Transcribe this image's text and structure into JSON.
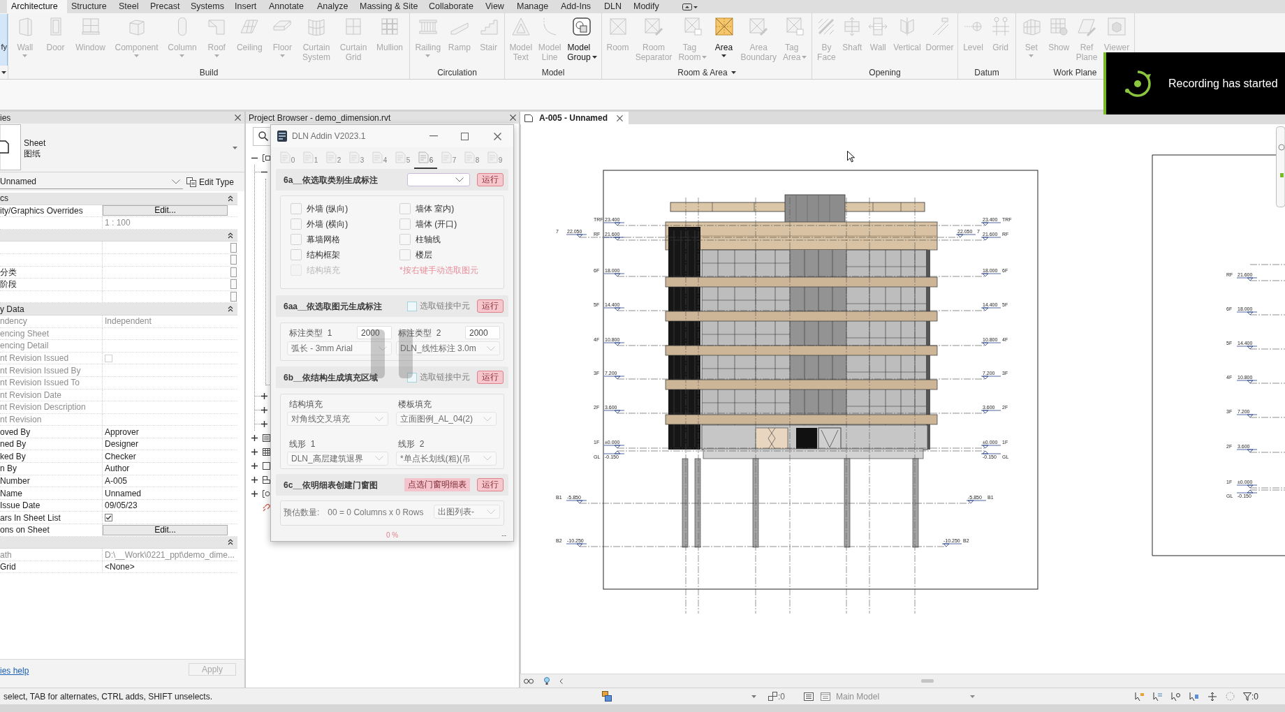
{
  "ribbon": {
    "tabs": [
      {
        "label": "Architecture",
        "selected": true
      },
      {
        "label": "Structure",
        "selected": false
      },
      {
        "label": "Steel",
        "selected": false
      },
      {
        "label": "Precast",
        "selected": false
      },
      {
        "label": "Systems",
        "selected": false
      },
      {
        "label": "Insert",
        "selected": false
      },
      {
        "label": "Annotate",
        "selected": false
      },
      {
        "label": "Analyze",
        "selected": false
      },
      {
        "label": "Massing & Site",
        "selected": false
      },
      {
        "label": "Collaborate",
        "selected": false
      },
      {
        "label": "View",
        "selected": false
      },
      {
        "label": "Manage",
        "selected": false
      },
      {
        "label": "Add-Ins",
        "selected": false
      },
      {
        "label": "DLN",
        "selected": false
      },
      {
        "label": "Modify",
        "selected": false
      }
    ],
    "modify_tool": {
      "label": "fy",
      "selected": true
    },
    "panels": [
      {
        "label": "Build",
        "menu": false,
        "tools": [
          {
            "label": "Wall",
            "disabled": true,
            "kind": "dropdown"
          },
          {
            "label": "Door",
            "disabled": true,
            "kind": "plain"
          },
          {
            "label": "Window",
            "disabled": true,
            "kind": "plain"
          },
          {
            "label": "Component",
            "disabled": true,
            "kind": "dropdown"
          },
          {
            "label": "Column",
            "disabled": true,
            "kind": "dropdown"
          },
          {
            "label": "Roof",
            "disabled": true,
            "kind": "dropdown"
          },
          {
            "label": "Ceiling",
            "disabled": true,
            "kind": "plain"
          },
          {
            "label": "Floor",
            "disabled": true,
            "kind": "dropdown"
          },
          {
            "label": "Curtain System",
            "disabled": true,
            "kind": "plain"
          },
          {
            "label": "Curtain Grid",
            "disabled": true,
            "kind": "plain"
          },
          {
            "label": "Mullion",
            "disabled": true,
            "kind": "plain"
          }
        ]
      },
      {
        "label": "Circulation",
        "menu": false,
        "tools": [
          {
            "label": "Railing",
            "disabled": true,
            "kind": "dropdown"
          },
          {
            "label": "Ramp",
            "disabled": true,
            "kind": "plain"
          },
          {
            "label": "Stair",
            "disabled": true,
            "kind": "plain"
          }
        ]
      },
      {
        "label": "Model",
        "menu": false,
        "tools": [
          {
            "label": "Model Text",
            "disabled": true,
            "kind": "plain"
          },
          {
            "label": "Model Line",
            "disabled": true,
            "kind": "plain"
          },
          {
            "label": "Model Group",
            "disabled": false,
            "kind": "sidemenu"
          }
        ]
      },
      {
        "label": "Room & Area",
        "menu": true,
        "tools": [
          {
            "label": "Room",
            "disabled": true,
            "kind": "plain"
          },
          {
            "label": "Room Separator",
            "disabled": true,
            "kind": "plain"
          },
          {
            "label": "Tag Room",
            "disabled": true,
            "kind": "sidemenu"
          },
          {
            "label": "Area",
            "disabled": false,
            "kind": "dropdown"
          },
          {
            "label": "Area Boundary",
            "disabled": true,
            "kind": "plain"
          },
          {
            "label": "Tag Area",
            "disabled": true,
            "kind": "sidemenu"
          }
        ]
      },
      {
        "label": "Opening",
        "menu": false,
        "tools": [
          {
            "label": "By Face",
            "disabled": true,
            "kind": "plain"
          },
          {
            "label": "Shaft",
            "disabled": true,
            "kind": "plain"
          },
          {
            "label": "Wall",
            "disabled": true,
            "kind": "plain"
          },
          {
            "label": "Vertical",
            "disabled": true,
            "kind": "plain"
          },
          {
            "label": "Dormer",
            "disabled": true,
            "kind": "plain"
          }
        ]
      },
      {
        "label": "Datum",
        "menu": false,
        "tools": [
          {
            "label": "Level",
            "disabled": true,
            "kind": "plain"
          },
          {
            "label": "Grid",
            "disabled": true,
            "kind": "plain"
          }
        ]
      },
      {
        "label": "Work Plane",
        "menu": false,
        "tools": [
          {
            "label": "Set",
            "disabled": true,
            "kind": "dropdown"
          },
          {
            "label": "Show",
            "disabled": true,
            "kind": "plain"
          },
          {
            "label": "Ref Plane",
            "disabled": true,
            "kind": "plain"
          },
          {
            "label": "Viewer",
            "disabled": true,
            "kind": "plain"
          }
        ]
      }
    ]
  },
  "recording_toast": {
    "message": "Recording has started"
  },
  "properties": {
    "title": "ies",
    "type_name": "Sheet",
    "type_subname": "图纸",
    "instance": "Unnamed",
    "edit_type": "Edit Type",
    "rows": [
      {
        "kind": "section",
        "label": "cs"
      },
      {
        "kind": "button",
        "label": "ity/Graphics Overrides",
        "value": "Edit..."
      },
      {
        "kind": "text",
        "value": "1 : 100",
        "disabled": true
      },
      {
        "kind": "section"
      },
      {
        "kind": "browse"
      },
      {
        "kind": "browse"
      },
      {
        "kind": "browse",
        "label": "分类"
      },
      {
        "kind": "browse",
        "label": "阶段"
      },
      {
        "kind": "browse"
      },
      {
        "kind": "section",
        "label": "y Data"
      },
      {
        "kind": "text",
        "label": "ndency",
        "value": "Independent",
        "disabled": true
      },
      {
        "kind": "text",
        "label": "encing Sheet",
        "disabled": true
      },
      {
        "kind": "text",
        "label": "encing Detail",
        "disabled": true
      },
      {
        "kind": "checkbox",
        "label": "nt Revision Issued",
        "checked": false,
        "disabled": true
      },
      {
        "kind": "text",
        "label": "nt Revision Issued By",
        "disabled": true
      },
      {
        "kind": "text",
        "label": "nt Revision Issued To",
        "disabled": true
      },
      {
        "kind": "text",
        "label": "nt Revision Date",
        "disabled": true
      },
      {
        "kind": "text",
        "label": "nt Revision Description",
        "disabled": true
      },
      {
        "kind": "text",
        "label": "nt Revision",
        "disabled": true
      },
      {
        "kind": "text",
        "label": "oved By",
        "value": "Approver",
        "disabled": false
      },
      {
        "kind": "text",
        "label": "ned By",
        "value": "Designer",
        "disabled": false
      },
      {
        "kind": "text",
        "label": "ked By",
        "value": "Checker",
        "disabled": false
      },
      {
        "kind": "text",
        "label": "n By",
        "value": "Author",
        "disabled": false
      },
      {
        "kind": "text",
        "label": "Number",
        "value": "A-005",
        "disabled": false
      },
      {
        "kind": "text",
        "label": "Name",
        "value": "Unnamed",
        "disabled": false
      },
      {
        "kind": "text",
        "label": "Issue Date",
        "value": "09/05/23",
        "disabled": false
      },
      {
        "kind": "checkbox",
        "label": "ars In Sheet List",
        "checked": true,
        "disabled": false
      },
      {
        "kind": "button",
        "label": "ons on Sheet",
        "value": "Edit..."
      },
      {
        "kind": "section"
      },
      {
        "kind": "text",
        "label": "ath",
        "value": "D:\\__Work\\0221_ppt\\demo_dime...",
        "disabled": true
      },
      {
        "kind": "text",
        "label": "Grid",
        "value": "<None>",
        "disabled": false
      }
    ],
    "help_link": "ies help",
    "apply": {
      "label": "Apply",
      "disabled": true
    }
  },
  "project_browser": {
    "title": "Project Browser - demo_dimension.rvt",
    "tree": [
      {
        "expanded": true,
        "children": [
          {
            "expanded": true
          },
          {
            "expanded": false
          },
          {
            "expanded": false
          },
          {
            "expanded": false
          }
        ]
      },
      {
        "expanded": false
      },
      {
        "expanded": false
      },
      {
        "expanded": false
      },
      {
        "expanded": false
      },
      {
        "expanded": false
      },
      {
        "leaf": true
      }
    ]
  },
  "addin_dialog": {
    "title": "DLN Addin V2023.1",
    "tabs": [
      {
        "label": "0",
        "selected": false
      },
      {
        "label": "1",
        "selected": false
      },
      {
        "label": "2",
        "selected": false
      },
      {
        "label": "3",
        "selected": false
      },
      {
        "label": "4",
        "selected": false
      },
      {
        "label": "5",
        "selected": false
      },
      {
        "label": "6",
        "selected": true
      },
      {
        "label": "7",
        "selected": false
      },
      {
        "label": "8",
        "selected": false
      },
      {
        "label": "9",
        "selected": false
      }
    ],
    "sections": [
      {
        "kind": "categories",
        "title": "6a__依选取类别生成标注",
        "run": "运行",
        "options": [
          {
            "label": "外墙 (纵向)",
            "checked": false,
            "disabled": false
          },
          {
            "label": "墙体 室内)",
            "checked": false,
            "disabled": false
          },
          {
            "label": "外墙 (横向)",
            "checked": false,
            "disabled": false
          },
          {
            "label": "墙体 (开口)",
            "checked": false,
            "disabled": false
          },
          {
            "label": "幕墙网格",
            "checked": false,
            "disabled": false
          },
          {
            "label": "柱轴线",
            "checked": false,
            "disabled": false
          },
          {
            "label": "结构框架",
            "checked": false,
            "disabled": false
          },
          {
            "label": "楼层",
            "checked": false,
            "disabled": false
          },
          {
            "label": "结构填充",
            "checked": false,
            "disabled": true
          }
        ],
        "hint": "*按右键手动选取图元"
      },
      {
        "kind": "pick",
        "title": "6aa__依选取图元生成标注",
        "link_option": {
          "label": "选取链接中元",
          "checked": false
        },
        "run": "运行",
        "fields": [
          {
            "label": "标注类型  1",
            "value": "2000",
            "style": "弧长 - 3mm Arial"
          },
          {
            "label": "标注类型  2",
            "value": "2000",
            "style": "DLN_线性标注 3.0m"
          }
        ]
      },
      {
        "kind": "fill",
        "title": "6b__依结构生成填充区域",
        "link_option": {
          "label": "选取链接中元",
          "checked": false
        },
        "run": "运行",
        "fields": [
          {
            "label": "结构填充",
            "value": "对角线交叉填充"
          },
          {
            "label": "楼板填充",
            "value": "立面图例_AL_04(2)"
          },
          {
            "label": "线形  1",
            "value": "DLN_高层建筑退界"
          },
          {
            "label": "线形  2",
            "value": "*单点长划线(粗)(吊"
          }
        ]
      },
      {
        "kind": "schedule",
        "title": "6c__依明细表创建门窗图",
        "action": "点选门窗明细表",
        "run": "运行",
        "count_label": "预估数量:",
        "count_value": "00 = 0 Columns x 0 Rows",
        "output": "出图列表-"
      }
    ],
    "progress": "0 %",
    "status": "--"
  },
  "view": {
    "tab": {
      "label": "A-005 - Unnamed",
      "selected": true
    },
    "sheet": {
      "levels_left": [
        {
          "name": "TRF",
          "elevation": "23.400"
        },
        {
          "name": "7",
          "elevation": "22.050"
        },
        {
          "name": "RF",
          "elevation": "21.600"
        },
        {
          "name": "6F",
          "elevation": "18.000"
        },
        {
          "name": "5F",
          "elevation": "14.400"
        },
        {
          "name": "4F",
          "elevation": "10.800"
        },
        {
          "name": "3F",
          "elevation": "7.200"
        },
        {
          "name": "2F",
          "elevation": "3.600"
        },
        {
          "name": "1F",
          "elevation": "±0.000"
        },
        {
          "name": "GL",
          "elevation": "-0.150"
        },
        {
          "name": "B1",
          "elevation": "-5.850"
        },
        {
          "name": "B2",
          "elevation": "-10.250"
        }
      ],
      "levels_right": [
        {
          "name": "TRF",
          "elevation": "23.400"
        },
        {
          "name": "7",
          "elevation": "22.050"
        },
        {
          "name": "RF",
          "elevation": "21.600"
        },
        {
          "name": "6F",
          "elevation": "18.000"
        },
        {
          "name": "5F",
          "elevation": "14.400"
        },
        {
          "name": "4F",
          "elevation": "10.800"
        },
        {
          "name": "3F",
          "elevation": "7.200"
        },
        {
          "name": "2F",
          "elevation": "3.600"
        },
        {
          "name": "1F",
          "elevation": "±0.000"
        },
        {
          "name": "GL",
          "elevation": "-0.150"
        },
        {
          "name": "B1",
          "elevation": "-5.850"
        },
        {
          "name": "B2",
          "elevation": "-10.250"
        }
      ]
    },
    "next_sheet": {
      "levels": [
        {
          "name": "RF",
          "elevation": "21.600"
        },
        {
          "name": "6F",
          "elevation": "18.000"
        },
        {
          "name": "5F",
          "elevation": "14.400"
        },
        {
          "name": "4F",
          "elevation": "10.800"
        },
        {
          "name": "3F",
          "elevation": "7.200"
        },
        {
          "name": "2F",
          "elevation": "3.600"
        },
        {
          "name": "1F",
          "elevation": "±0.000"
        },
        {
          "name": "GL",
          "elevation": "-0.150"
        }
      ]
    }
  },
  "status_bar": {
    "prompt": "select, TAB for alternates, CTRL adds, SHIFT unselects.",
    "indicator_count": ":0",
    "model": "Main Model",
    "filter_count": ":0"
  }
}
